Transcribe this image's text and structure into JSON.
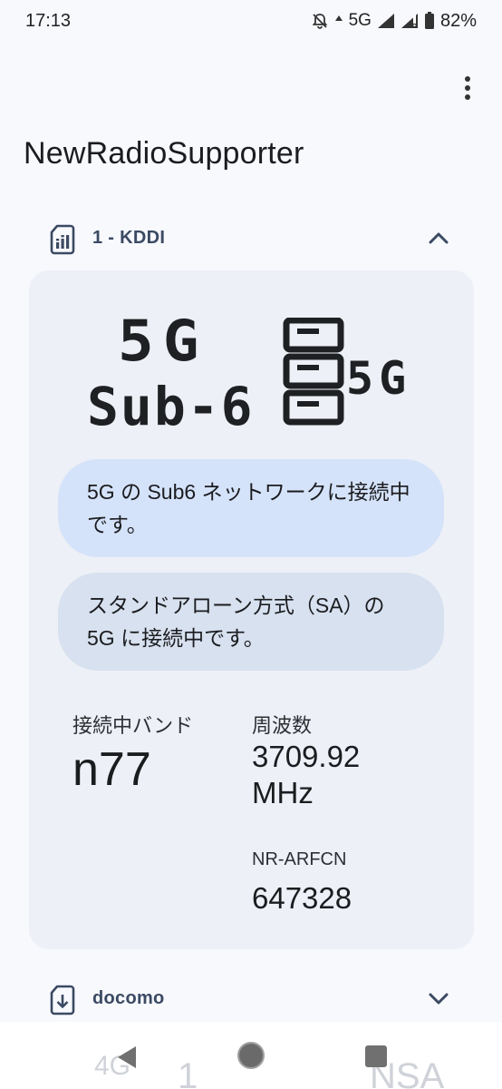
{
  "status_bar": {
    "time": "17:13",
    "network": "5G",
    "battery": "82%"
  },
  "app": {
    "title": "NewRadioSupporter"
  },
  "sim1": {
    "label": "1 - KDDI",
    "expanded": true,
    "tech_line1": "5G",
    "tech_line2": "Sub-6",
    "sa_icon_text": "5G",
    "message_1": "5G の Sub6 ネットワークに接続中です。",
    "message_2": "スタンドアローン方式（SA）の 5G に接続中です。",
    "band_label": "接続中バンド",
    "band_value": "n77",
    "freq_label": "周波数",
    "freq_value_1": "3709.92",
    "freq_value_2": "MHz",
    "arfcn_label": "NR-ARFCN",
    "arfcn_value": "647328"
  },
  "sim2": {
    "label": "docomo",
    "expanded": false
  },
  "nav_ghost": {
    "left": "4G",
    "middle": "1",
    "right": "NSA"
  },
  "colors": {
    "background": "#f8f9fd",
    "card": "#edf0f6",
    "bubble_primary": "#d5e3fa",
    "bubble_secondary": "#d7e1ef",
    "header_text": "#3b4a63"
  }
}
